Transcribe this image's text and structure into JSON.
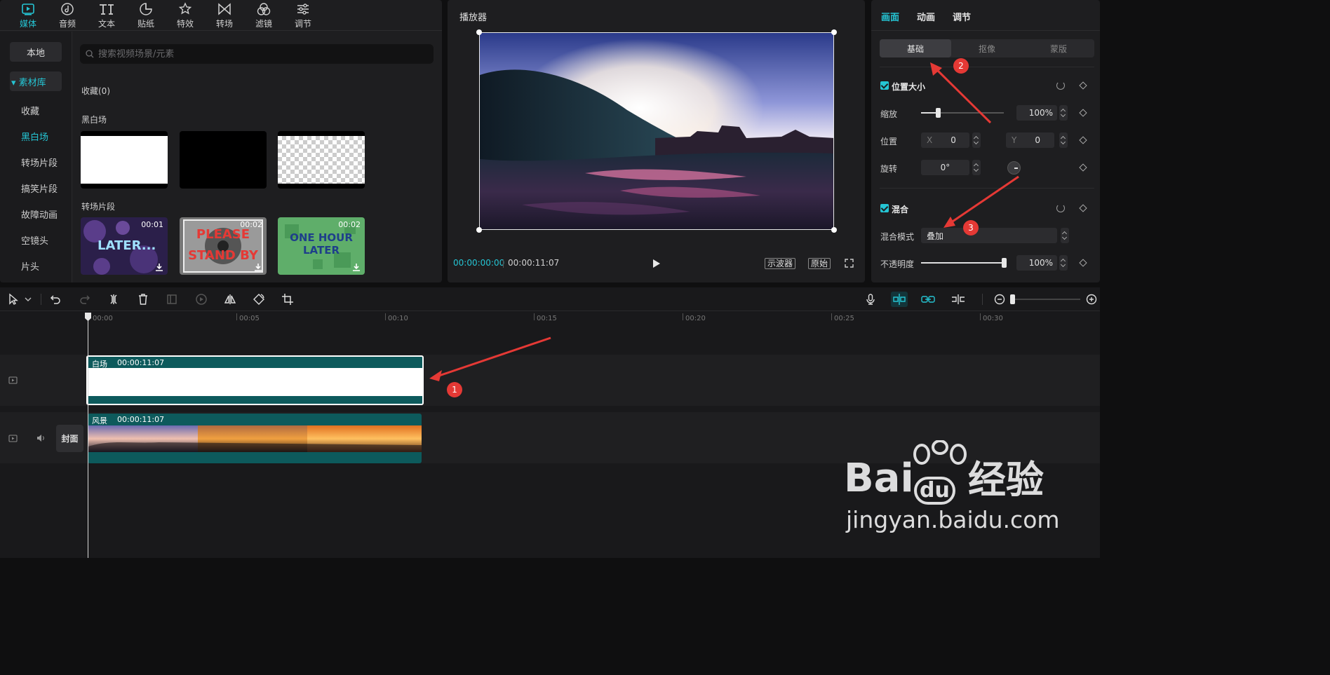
{
  "media_tabs": [
    {
      "label": "媒体",
      "icon": "media-icon",
      "active": true
    },
    {
      "label": "音频",
      "icon": "audio-icon"
    },
    {
      "label": "文本",
      "icon": "text-icon"
    },
    {
      "label": "贴纸",
      "icon": "sticker-icon"
    },
    {
      "label": "特效",
      "icon": "effects-icon"
    },
    {
      "label": "转场",
      "icon": "transition-icon"
    },
    {
      "label": "滤镜",
      "icon": "filter-icon"
    },
    {
      "label": "调节",
      "icon": "adjust-icon"
    }
  ],
  "sidebar": {
    "local": "本地",
    "library": "▾ 素材库",
    "items": [
      "收藏",
      "黑白场",
      "转场片段",
      "搞笑片段",
      "故障动画",
      "空镜头",
      "片头"
    ]
  },
  "search": {
    "placeholder": "搜索视频场景/元素"
  },
  "sections": {
    "favorites": "收藏(0)",
    "black_white": "黑白场",
    "transition_clips": "转场片段"
  },
  "transition_thumbs": [
    {
      "text": "LATER...",
      "duration": "00:01"
    },
    {
      "text": "PLEASE STAND BY",
      "duration": "00:02"
    },
    {
      "text": "ONE HOUR LATER",
      "duration": "00:02"
    }
  ],
  "player": {
    "title": "播放器",
    "current_time": "00:00:00:00",
    "total_time": "00:00:11:07",
    "scope_btn": "示波器",
    "original_btn": "原始"
  },
  "props": {
    "tabs": [
      "画面",
      "动画",
      "调节"
    ],
    "seg": [
      "基础",
      "抠像",
      "蒙版"
    ],
    "position_size": {
      "title": "位置大小",
      "scale_label": "缩放",
      "scale_value": "100%",
      "scale_fraction": 0.2,
      "position_label": "位置",
      "x_label": "X",
      "x_value": "0",
      "y_label": "Y",
      "y_value": "0",
      "rotate_label": "旋转",
      "rotate_value": "0°"
    },
    "blend": {
      "title": "混合",
      "mode_label": "混合模式",
      "mode_value": "叠加",
      "opacity_label": "不透明度",
      "opacity_value": "100%",
      "opacity_fraction": 1.0
    }
  },
  "timeline": {
    "ticks": [
      "00:00",
      "00:05",
      "00:10",
      "00:15",
      "00:20",
      "00:25",
      "00:30"
    ],
    "clip_white": {
      "label": "白场",
      "duration": "00:00:11:07"
    },
    "clip_scene": {
      "label": "风景",
      "duration": "00:00:11:07"
    },
    "cover_label": "封面"
  },
  "annotations": [
    "1",
    "2",
    "3"
  ],
  "watermark": {
    "brand_a": "Bai",
    "brand_b": "du",
    "cn": "经验",
    "url": "jingyan.baidu.com"
  }
}
